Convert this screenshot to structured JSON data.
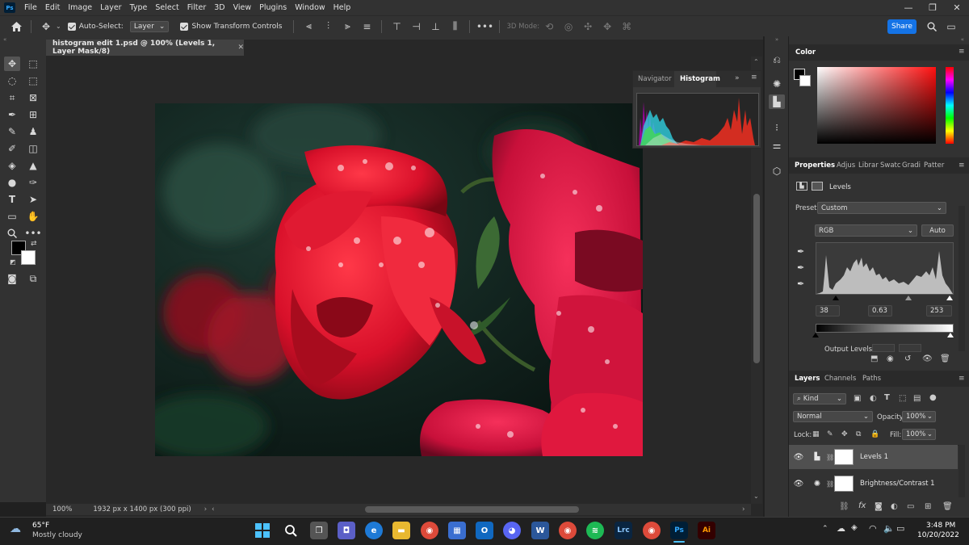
{
  "menubar": {
    "items": [
      "File",
      "Edit",
      "Image",
      "Layer",
      "Type",
      "Select",
      "Filter",
      "3D",
      "View",
      "Plugins",
      "Window",
      "Help"
    ],
    "logo": "Ps"
  },
  "options": {
    "auto_select_label": "Auto-Select:",
    "auto_select_value": "Layer",
    "transform_label": "Show Transform Controls",
    "mode_3d_label": "3D Mode:",
    "share_label": "Share"
  },
  "document": {
    "tab_title": "histogram edit 1.psd @ 100% (Levels 1, Layer Mask/8)",
    "zoom": "100%",
    "dimensions": "1932 px x 1400 px (300 ppi)"
  },
  "histogram_panel": {
    "tabs": [
      "Navigator",
      "Histogram"
    ],
    "active_tab": "Histogram"
  },
  "color_panel": {
    "title": "Color"
  },
  "properties": {
    "tabs": [
      "Properties",
      "Adjus",
      "Librar",
      "Swatc",
      "Gradi",
      "Patter"
    ],
    "adjustment_name": "Levels",
    "preset_label": "Preset:",
    "preset_value": "Custom",
    "channel_value": "RGB",
    "auto_label": "Auto",
    "input_black": "38",
    "input_gamma": "0.63",
    "input_white": "253",
    "output_label": "Output Levels:"
  },
  "layers_panel": {
    "tabs": [
      "Layers",
      "Channels",
      "Paths"
    ],
    "kind_label": "Kind",
    "blend_mode": "Normal",
    "opacity_label": "Opacity:",
    "opacity_value": "100%",
    "lock_label": "Lock:",
    "fill_label": "Fill:",
    "fill_value": "100%",
    "layers": [
      {
        "name": "Levels 1"
      },
      {
        "name": "Brightness/Contrast 1"
      }
    ]
  },
  "taskbar": {
    "weather_temp": "65°F",
    "weather_desc": "Mostly cloudy",
    "time": "3:48 PM",
    "date": "10/20/2022",
    "apps": [
      "Lrc",
      "Ps",
      "Ai"
    ]
  },
  "colors": {
    "accent": "#1473e6",
    "ps_blue": "#31a8ff",
    "panel_bg": "#323232",
    "canvas_bg": "#282828"
  }
}
